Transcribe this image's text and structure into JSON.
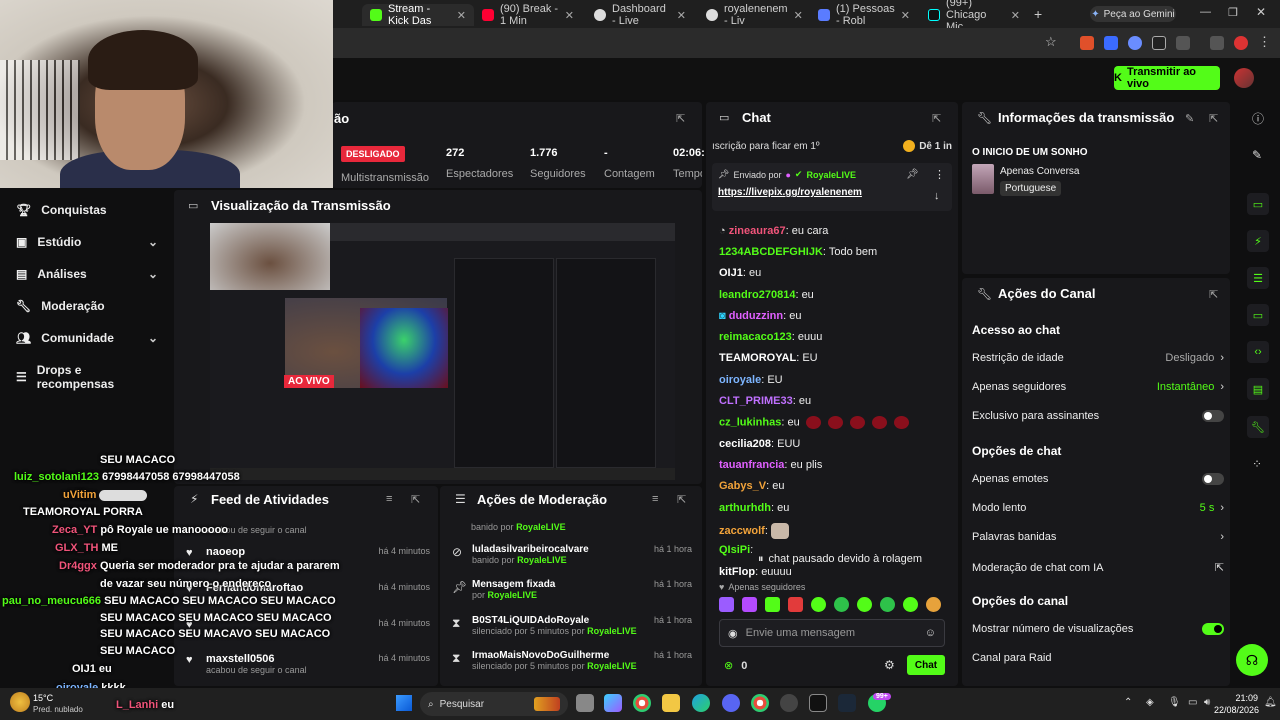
{
  "browser": {
    "tabs": [
      {
        "label": "Stream - Kick Das",
        "active": true
      },
      {
        "label": "(90) Break - 1 Min"
      },
      {
        "label": "Dashboard - Live"
      },
      {
        "label": "royalenenem - Liv"
      },
      {
        "label": "(1) Pessoas - Robl"
      },
      {
        "label": "(99+) Chicago Mic"
      }
    ],
    "gemini_label": "Peça ao Gemini"
  },
  "header": {
    "go_live_label": "Transmitir ao vivo"
  },
  "stream_panel": {
    "title_fragment": "ão",
    "status_badge": "DESLIGADO",
    "multistream_label": "Multistransmissão",
    "stats": [
      {
        "value": "272",
        "label": "Espectadores"
      },
      {
        "value": "1.776",
        "label": "Seguidores"
      },
      {
        "value": "-",
        "label": "Contagem"
      },
      {
        "value": "02:06:",
        "label": "Tempo"
      }
    ]
  },
  "sidebar": {
    "items": [
      {
        "label": "Conquistas",
        "icon": "trophy-icon"
      },
      {
        "label": "Estúdio",
        "icon": "studio-icon",
        "chevron": true
      },
      {
        "label": "Análises",
        "icon": "chart-icon",
        "chevron": true
      },
      {
        "label": "Moderação",
        "icon": "wrench-icon"
      },
      {
        "label": "Comunidade",
        "icon": "people-icon",
        "chevron": true
      },
      {
        "label": "Drops e recompensas",
        "icon": "drops-icon"
      }
    ]
  },
  "preview": {
    "title": "Visualização da Transmissão",
    "live_badge": "AO VIVO"
  },
  "feed": {
    "title": "Feed de Atividades",
    "top_fragment": "acabou de seguir o canal",
    "items": [
      {
        "name": "naoeop",
        "sub": "",
        "time": "há 4 minutos"
      },
      {
        "name": "Fernandomaroftao",
        "sub": "",
        "time": "há 4 minutos"
      },
      {
        "name": "",
        "sub": "",
        "time": "há 4 minutos"
      },
      {
        "name": "maxstell0506",
        "sub": "acabou de seguir o canal",
        "time": "há 4 minutos"
      }
    ]
  },
  "moderation": {
    "title": "Ações de Moderação",
    "top_fragment_prefix": "banido por",
    "top_fragment_user": "RoyaleLIVE",
    "items": [
      {
        "icon": "ban-icon",
        "name": "luladasilvaribeirocalvare",
        "sub_prefix": "banido por",
        "sub_user": "RoyaleLIVE",
        "time": "há 1 hora"
      },
      {
        "icon": "pin-icon",
        "name": "Mensagem fixada",
        "sub_prefix": "por",
        "sub_user": "RoyaleLIVE",
        "time": "há 1 hora"
      },
      {
        "icon": "hourglass-icon",
        "name": "B0ST4LiQUIDAdoRoyale",
        "sub_prefix": "silenciado por 5 minutos por",
        "sub_user": "RoyaleLIVE",
        "time": "há 1 hora"
      },
      {
        "icon": "hourglass-icon",
        "name": "IrmaoMaisNovoDoGuilherme",
        "sub_prefix": "silenciado por 5 minutos por",
        "sub_user": "RoyaleLIVE",
        "time": "há 1 hora"
      }
    ]
  },
  "chat": {
    "title": "Chat",
    "banner_text": "ıscrição para ficar em 1º",
    "banner_right": "Dê 1 in",
    "pinned_label": "Enviado por",
    "pinned_user": "RoyaleLIVE",
    "pinned_link": "https://livepix.gg/royalenenem",
    "messages": [
      {
        "user": "zineaura67",
        "text": "eu cara",
        "color": "#f0547a"
      },
      {
        "user": "1234ABCDEFGHIJK",
        "text": "Todo bem",
        "color": "#53fc18"
      },
      {
        "user": "OIJ1",
        "text": "eu",
        "color": "#ffffff"
      },
      {
        "user": "leandro270814",
        "text": "eu",
        "color": "#53fc18"
      },
      {
        "user": "duduzzinn",
        "text": "eu",
        "color": "#e060ff"
      },
      {
        "user": "reimacaco123",
        "text": "euuu",
        "color": "#53fc18"
      },
      {
        "user": "TEAMOROYAL",
        "text": "EU",
        "color": "#ffffff"
      },
      {
        "user": "oiroyale",
        "text": "EU",
        "color": "#7db5ff"
      },
      {
        "user": "CLT_PRIME33",
        "text": "eu",
        "color": "#c070ff"
      },
      {
        "user": "cz_lukinhas",
        "text": "eu",
        "color": "#53fc18"
      },
      {
        "user": "cecilia208",
        "text": "EUU",
        "color": "#ffffff"
      },
      {
        "user": "tauanfrancia",
        "text": "eu plis",
        "color": "#e060ff"
      },
      {
        "user": "Gabys_V",
        "text": "eu",
        "color": "#f2a33a"
      },
      {
        "user": "arthurhdh",
        "text": "eu",
        "color": "#53fc18"
      },
      {
        "user": "zaccwolf",
        "text": "",
        "color": "#f2a33a"
      },
      {
        "user": "QIsiPi",
        "text": "",
        "color": "#53fc18"
      },
      {
        "user": "kitFlop",
        "text": "euuuu",
        "color": "#ffffff"
      }
    ],
    "paused_text": "chat pausado devido à rolagem",
    "followers_only": "Apenas seguidores",
    "input_placeholder": "Envie uma mensagem",
    "points": "0",
    "send_label": "Chat"
  },
  "stream_info": {
    "title": "Informações da transmissão",
    "stream_title": "O INICIO DE UM SONHO",
    "category": "Apenas Conversa",
    "language": "Portuguese"
  },
  "channel_actions": {
    "title": "Ações do Canal",
    "chat_access_heading": "Acesso ao chat",
    "rows_access": [
      {
        "label": "Restrição de idade",
        "value": "Desligado",
        "kind": "chevron"
      },
      {
        "label": "Apenas seguidores",
        "value": "Instantâneo",
        "kind": "chevron-green"
      },
      {
        "label": "Exclusivo para assinantes",
        "value": "",
        "kind": "toggle-off"
      }
    ],
    "chat_options_heading": "Opções de chat",
    "rows_chat": [
      {
        "label": "Apenas emotes",
        "value": "",
        "kind": "toggle-off"
      },
      {
        "label": "Modo lento",
        "value": "5 s",
        "kind": "chevron-green"
      },
      {
        "label": "Palavras banidas",
        "value": "",
        "kind": "chevron"
      },
      {
        "label": "Moderação de chat com IA",
        "value": "",
        "kind": "external"
      }
    ],
    "channel_options_heading": "Opções do canal",
    "rows_channel": [
      {
        "label": "Mostrar número de visualizações",
        "value": "",
        "kind": "toggle-on"
      },
      {
        "label": "Canal para Raid",
        "value": "",
        "kind": "none"
      }
    ]
  },
  "overlay_chat": [
    {
      "user": "",
      "text": "SEU MACACO",
      "color": "#ffffff"
    },
    {
      "user": "luiz_sotolani123",
      "text": "67998447058 67998447058",
      "color": "#53fc18"
    },
    {
      "user": "uVitim",
      "text": "",
      "color": "#f2a33a"
    },
    {
      "user": "TEAMOROYAL",
      "text": "PORRA",
      "color": "#ffffff"
    },
    {
      "user": "Zeca_YT",
      "text": "pô Royale ue manooooo",
      "color": "#f0547a"
    },
    {
      "user": "GLX_TH",
      "text": "ME",
      "color": "#f0547a"
    },
    {
      "user": "Dr4ggx",
      "text": "Queria ser moderador pra te ajudar a pararem",
      "color": "#f0547a"
    },
    {
      "user": "",
      "text": "de vazar seu número o endereço",
      "color": "#ffffff"
    },
    {
      "user": "pau_no_meucu666",
      "text": "SEU MACACO SEU MACACO SEU MACACO",
      "color": "#53fc18"
    },
    {
      "user": "",
      "text": "SEU MACACO SEU MACACO SEU MACACO",
      "color": "#ffffff"
    },
    {
      "user": "",
      "text": "SEU MACACO SEU MACAVO SEU MACACO",
      "color": "#ffffff"
    },
    {
      "user": "",
      "text": "SEU MACACO",
      "color": "#ffffff"
    },
    {
      "user": "OIJ1",
      "text": "eu",
      "color": "#ffffff"
    },
    {
      "user": "oiroyale",
      "text": "kkkk",
      "color": "#7db5ff"
    },
    {
      "user": "L_Lanhi",
      "text": "eu",
      "color": "#f0547a"
    }
  ],
  "taskbar": {
    "weather_temp": "15°C",
    "weather_desc": "Pred. nublado",
    "search_label": "Pesquisar",
    "badge": "99+",
    "time": "21:09",
    "date": "22/08/2026"
  },
  "colors": {
    "accent": "#53fc18",
    "panel": "#18181b",
    "bg": "#0f0f10",
    "live": "#e8283b"
  }
}
